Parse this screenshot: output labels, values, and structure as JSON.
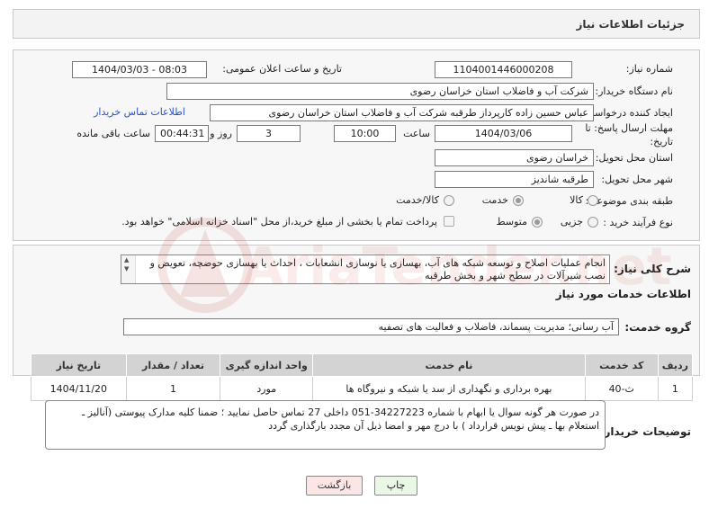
{
  "header": {
    "title": "جزئیات اطلاعات نیاز"
  },
  "form": {
    "need_number_label": "شماره نیاز:",
    "need_number": "1104001446000208",
    "announce_label": "تاریخ و ساعت اعلان عمومی:",
    "announce_value": "1404/03/03 - 08:03",
    "buyer_org_label": "نام دستگاه خریدار:",
    "buyer_org": "شرکت آب و فاضلاب استان خراسان رضوی",
    "creator_label": "ایجاد کننده درخواست:",
    "creator": "عباس حسین زاده کارپرداز طرقبه  شرکت آب و فاضلاب استان خراسان رضوی",
    "contact_link": "اطلاعات تماس خریدار",
    "deadline_label": "مهلت ارسال پاسخ: تا تاریخ:",
    "deadline_date": "1404/03/06",
    "time_label": "ساعت",
    "deadline_time": "10:00",
    "days_value": "3",
    "days_label": "روز و",
    "remaining_time": "00:44:31",
    "remaining_label": "ساعت باقی مانده",
    "province_label": "استان محل تحویل:",
    "province": "خراسان رضوی",
    "city_label": "شهر محل تحویل:",
    "city": "طرقبه شاندیز",
    "category_label": "طبقه بندی موضوعی:",
    "category_options": [
      "کالا",
      "خدمت",
      "کالا/خدمت"
    ],
    "category_selected": 1,
    "process_label": "نوع فرآیند خرید :",
    "process_options": [
      "جزیی",
      "متوسط"
    ],
    "process_selected": 1,
    "payment_text": "پرداخت تمام یا بخشی از مبلغ خرید،از محل \"اسناد خزانه اسلامی\" خواهد بود."
  },
  "summary": {
    "label": "شرح کلی نیاز:",
    "text": "انجام عملیات اصلاح و توسعه شبکه های آب، بهسازی یا نوسازی انشعابات ، احداث یا بهسازی حوضچه، تعویض و نصب شیرآلات در سطح شهر و بخش طرقبه"
  },
  "services": {
    "section_title": "اطلاعات خدمات مورد نیاز",
    "group_label": "گروه خدمت:",
    "group_value": "آب رسانی؛ مدیریت پسماند، فاضلاب و فعالیت های تصفیه",
    "columns": [
      "ردیف",
      "کد خدمت",
      "نام خدمت",
      "واحد اندازه گیری",
      "تعداد / مقدار",
      "تاریخ نیاز"
    ],
    "rows": [
      [
        "1",
        "ث-40",
        "بهره برداری و نگهداری از سد یا شبکه و نیروگاه ها",
        "مورد",
        "1",
        "1404/11/20"
      ]
    ]
  },
  "notes": {
    "label": "توضیحات خریدار:",
    "text": "در صورت هر گونه سوال یا ابهام با شماره 34227223-051 داخلی 27 تماس حاصل نمایید ؛ ضمنا کلیه مدارک پیوستی (آنالیز ـ استعلام بها ـ پیش نویس قرارداد ) با درج مهر و امضا ذیل آن مجدد بارگذاری گردد"
  },
  "buttons": {
    "print": "چاپ",
    "back": "بازگشت"
  },
  "watermark": {
    "text": "AriaTender.net"
  }
}
